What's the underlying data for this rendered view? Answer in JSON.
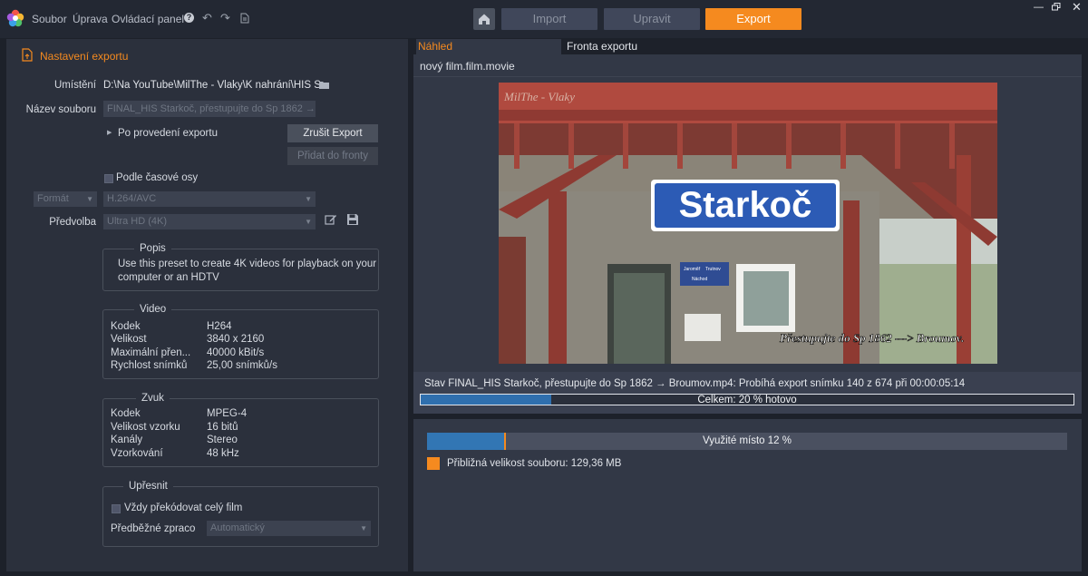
{
  "menu": {
    "file": "Soubor",
    "edit": "Úprava",
    "control_panel": "Ovládací panel"
  },
  "modes": {
    "import": "Import",
    "edit": "Upravit",
    "export": "Export"
  },
  "settings": {
    "title": "Nastavení exportu",
    "location_label": "Umístění",
    "location_value": "D:\\Na YouTube\\MilThe - Vlaky\\K nahrání\\HIS S...",
    "filename_label": "Název souboru",
    "filename_value": "FINAL_HIS Starkoč, přestupujte do Sp 1862 →",
    "after_export": "Po provedení exportu",
    "cancel_export": "Zrušit Export",
    "add_to_queue": "Přidat do fronty",
    "timeline_label": "Podle časové osy",
    "format_label": "Formát",
    "format_value": "H.264/AVC",
    "preset_label": "Předvolba",
    "preset_value": "Ultra HD (4K)"
  },
  "description": {
    "title": "Popis",
    "text_line1": "Use this preset to create 4K videos for playback on your",
    "text_line2": "computer or an HDTV"
  },
  "video": {
    "title": "Video",
    "rows": [
      {
        "key": "Kodek",
        "value": "H264"
      },
      {
        "key": "Velikost",
        "value": "3840 x 2160"
      },
      {
        "key": "Maximální přen...",
        "value": "40000 kBit/s"
      },
      {
        "key": "Rychlost snímků",
        "value": "25,00 snímků/s"
      }
    ]
  },
  "audio": {
    "title": "Zvuk",
    "rows": [
      {
        "key": "Kodek",
        "value": "MPEG-4"
      },
      {
        "key": "Velikost vzorku",
        "value": "16 bitů"
      },
      {
        "key": "Kanály",
        "value": "Stereo"
      },
      {
        "key": "Vzorkování",
        "value": "48 kHz"
      }
    ]
  },
  "refine": {
    "title": "Upřesnit",
    "always_recode": "Vždy překódovat celý film",
    "preprocess_label": "Předběžné zpraco",
    "preprocess_value": "Automatický"
  },
  "tabs": {
    "preview": "Náhled",
    "queue": "Fronta exportu"
  },
  "preview": {
    "file_title": "nový film.film.movie",
    "image": {
      "watermark": "MilThe - Vlaky",
      "station_sign": "Starkoč",
      "overlay_caption": "Přestupujte do Sp 1862 ---> Broumov.",
      "small_sign_1": "Jaroměř",
      "small_sign_2": "Trutnov",
      "small_sign_3": "Náchod"
    }
  },
  "export_status": {
    "status_text": "Stav FINAL_HIS Starkoč, přestupujte do Sp 1862 → Broumov.mp4: Probíhá export snímku 140 z 674 při 00:00:05:14",
    "total_label": "Celkem: 20 % hotovo",
    "total_progress": 0.2
  },
  "disk": {
    "label": "Využité místo 12 %",
    "used_fraction": 0.12,
    "estimated_size": "Přibližná velikost souboru: 129,36 MB"
  },
  "colors": {
    "accent": "#f58a1f",
    "progress": "#2f6fae",
    "panel": "#2b303c",
    "background": "#1d212a"
  }
}
